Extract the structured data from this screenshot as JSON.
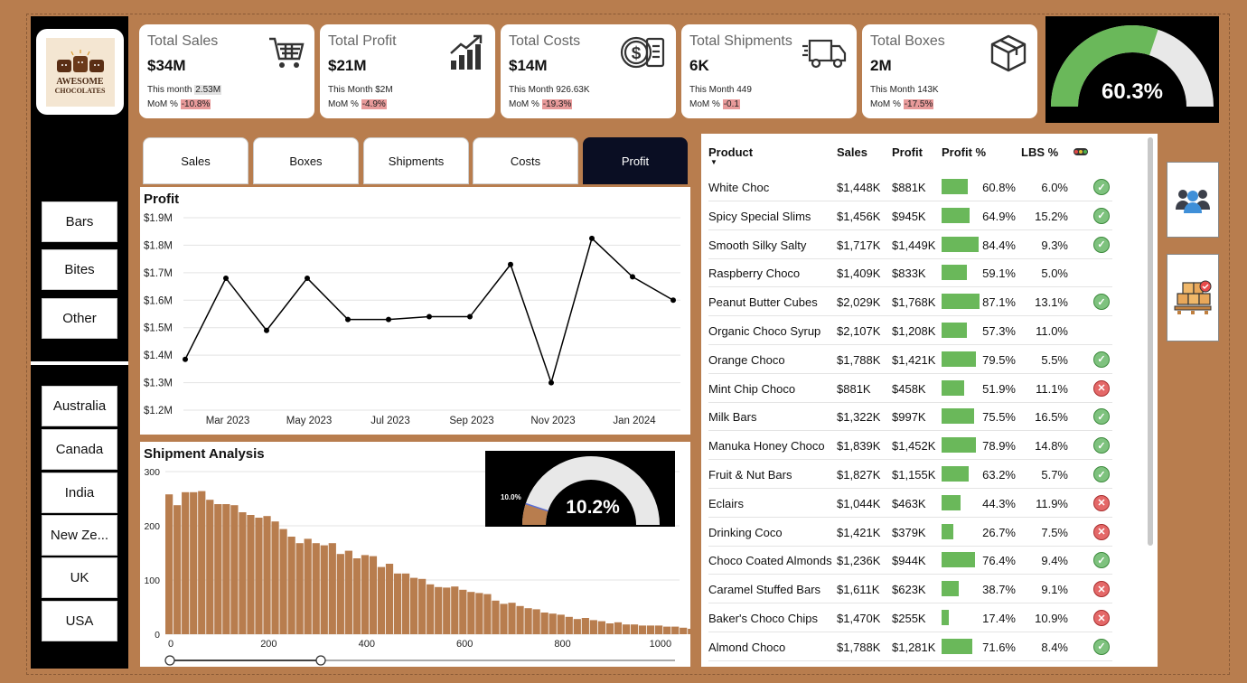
{
  "logo": {
    "line1": "AWESOME",
    "line2": "CHOCOLATES"
  },
  "product_slicer": [
    "Bars",
    "Bites",
    "Other"
  ],
  "country_slicer": [
    "Australia",
    "Canada",
    "India",
    "New Ze...",
    "UK",
    "USA"
  ],
  "kpis": [
    {
      "title": "Total Sales",
      "value": "$34M",
      "sub_label": "This month",
      "sub_value": "2.53M",
      "mom_label": "MoM %",
      "mom_value": "-10.8%",
      "icon": "shopping-cart-icon"
    },
    {
      "title": "Total Profit",
      "value": "$21M",
      "sub_label": "This Month",
      "sub_value": "$2M",
      "mom_label": "MoM %",
      "mom_value": "-4.9%",
      "icon": "growth-chart-icon"
    },
    {
      "title": "Total Costs",
      "value": "$14M",
      "sub_label": "This Month",
      "sub_value": "926.63K",
      "mom_label": "MoM %",
      "mom_value": "-19.3%",
      "icon": "dollar-invoice-icon"
    },
    {
      "title": "Total Shipments",
      "value": "6K",
      "sub_label": "This Month",
      "sub_value": "449",
      "mom_label": "MoM %",
      "mom_value": "-0.1",
      "icon": "truck-icon"
    },
    {
      "title": "Total Boxes",
      "value": "2M",
      "sub_label": "This Month",
      "sub_value": "143K",
      "mom_label": "MoM %",
      "mom_value": "-17.5%",
      "icon": "box-icon"
    }
  ],
  "main_gauge": {
    "label": "60.3%",
    "value": 0.603,
    "fill_color": "#6ab85a",
    "track_color": "#e8e8e8"
  },
  "tabs": [
    {
      "label": "Sales",
      "active": false
    },
    {
      "label": "Boxes",
      "active": false
    },
    {
      "label": "Shipments",
      "active": false
    },
    {
      "label": "Costs",
      "active": false
    },
    {
      "label": "Profit",
      "active": true
    }
  ],
  "chart_data": [
    {
      "type": "line",
      "title": "Profit",
      "x": [
        "2023-01",
        "2023-02",
        "2023-03",
        "2023-04",
        "2023-05",
        "2023-06",
        "2023-07",
        "2023-08",
        "2023-09",
        "2023-10",
        "2023-11",
        "2023-12",
        "2024-01",
        "2024-02",
        "2024-03"
      ],
      "values": [
        1.385,
        1.68,
        1.49,
        1.68,
        1.53,
        1.53,
        1.54,
        1.54,
        1.73,
        1.3,
        1.825,
        1.685,
        1.6
      ],
      "ylim": [
        1.2,
        1.9
      ],
      "yticks": [
        "$1.2M",
        "$1.3M",
        "$1.4M",
        "$1.5M",
        "$1.6M",
        "$1.7M",
        "$1.8M",
        "$1.9M"
      ],
      "ytick_values": [
        1.2,
        1.3,
        1.4,
        1.5,
        1.6,
        1.7,
        1.8,
        1.9
      ],
      "xticks": [
        "Mar 2023",
        "May 2023",
        "Jul 2023",
        "Sep 2023",
        "Nov 2023",
        "Jan 2024"
      ],
      "xtick_positions": [
        2,
        4,
        6,
        8,
        10,
        12
      ],
      "grid": true
    },
    {
      "type": "bar",
      "title": "Shipment Analysis",
      "xlim": [
        0,
        1050
      ],
      "ylim": [
        0,
        300
      ],
      "yticks": [
        "0",
        "100",
        "200",
        "300"
      ],
      "ytick_values": [
        0,
        100,
        200,
        300
      ],
      "xticks": [
        "0",
        "200",
        "400",
        "600",
        "800",
        "1000"
      ],
      "xtick_values": [
        0,
        200,
        400,
        600,
        800,
        1000
      ],
      "bar_color": "#b87d4e",
      "bin_width": 16.67,
      "values": [
        258,
        238,
        262,
        262,
        264,
        248,
        240,
        240,
        238,
        225,
        220,
        215,
        218,
        208,
        194,
        180,
        168,
        176,
        168,
        164,
        168,
        148,
        154,
        140,
        146,
        144,
        124,
        130,
        112,
        112,
        104,
        102,
        92,
        87,
        86,
        88,
        82,
        78,
        76,
        74,
        62,
        56,
        58,
        52,
        48,
        46,
        40,
        38,
        36,
        32,
        28,
        30,
        26,
        24,
        20,
        22,
        18,
        18,
        16,
        16,
        16,
        14,
        14,
        12,
        10,
        12,
        8
      ]
    }
  ],
  "small_gauge": {
    "label": "10.2%",
    "target_label": "10.0%",
    "value": 0.102,
    "fill_color": "#b87d4e",
    "track_color": "#e8e8e8"
  },
  "table": {
    "headers": {
      "product": "Product",
      "sales": "Sales",
      "profit": "Profit",
      "profit_pct": "Profit %",
      "lbs_pct": "LBS %"
    },
    "rows": [
      {
        "product": "White Choc",
        "sales": "$1,448K",
        "profit": "$881K",
        "profit_pct": "60.8%",
        "pct_value": 60.8,
        "lbs": "6.0%",
        "status": "ok"
      },
      {
        "product": "Spicy Special Slims",
        "sales": "$1,456K",
        "profit": "$945K",
        "profit_pct": "64.9%",
        "pct_value": 64.9,
        "lbs": "15.2%",
        "status": "ok"
      },
      {
        "product": "Smooth Silky Salty",
        "sales": "$1,717K",
        "profit": "$1,449K",
        "profit_pct": "84.4%",
        "pct_value": 84.4,
        "lbs": "9.3%",
        "status": "ok"
      },
      {
        "product": "Raspberry Choco",
        "sales": "$1,409K",
        "profit": "$833K",
        "profit_pct": "59.1%",
        "pct_value": 59.1,
        "lbs": "5.0%",
        "status": "none"
      },
      {
        "product": "Peanut Butter Cubes",
        "sales": "$2,029K",
        "profit": "$1,768K",
        "profit_pct": "87.1%",
        "pct_value": 87.1,
        "lbs": "13.1%",
        "status": "ok"
      },
      {
        "product": "Organic Choco Syrup",
        "sales": "$2,107K",
        "profit": "$1,208K",
        "profit_pct": "57.3%",
        "pct_value": 57.3,
        "lbs": "11.0%",
        "status": "none"
      },
      {
        "product": "Orange Choco",
        "sales": "$1,788K",
        "profit": "$1,421K",
        "profit_pct": "79.5%",
        "pct_value": 79.5,
        "lbs": "5.5%",
        "status": "ok"
      },
      {
        "product": "Mint Chip Choco",
        "sales": "$881K",
        "profit": "$458K",
        "profit_pct": "51.9%",
        "pct_value": 51.9,
        "lbs": "11.1%",
        "status": "bad"
      },
      {
        "product": "Milk Bars",
        "sales": "$1,322K",
        "profit": "$997K",
        "profit_pct": "75.5%",
        "pct_value": 75.5,
        "lbs": "16.5%",
        "status": "ok"
      },
      {
        "product": "Manuka Honey Choco",
        "sales": "$1,839K",
        "profit": "$1,452K",
        "profit_pct": "78.9%",
        "pct_value": 78.9,
        "lbs": "14.8%",
        "status": "ok"
      },
      {
        "product": "Fruit & Nut Bars",
        "sales": "$1,827K",
        "profit": "$1,155K",
        "profit_pct": "63.2%",
        "pct_value": 63.2,
        "lbs": "5.7%",
        "status": "ok"
      },
      {
        "product": "Eclairs",
        "sales": "$1,044K",
        "profit": "$463K",
        "profit_pct": "44.3%",
        "pct_value": 44.3,
        "lbs": "11.9%",
        "status": "bad"
      },
      {
        "product": "Drinking Coco",
        "sales": "$1,421K",
        "profit": "$379K",
        "profit_pct": "26.7%",
        "pct_value": 26.7,
        "lbs": "7.5%",
        "status": "bad"
      },
      {
        "product": "Choco Coated Almonds",
        "sales": "$1,236K",
        "profit": "$944K",
        "profit_pct": "76.4%",
        "pct_value": 76.4,
        "lbs": "9.4%",
        "status": "ok"
      },
      {
        "product": "Caramel Stuffed Bars",
        "sales": "$1,611K",
        "profit": "$623K",
        "profit_pct": "38.7%",
        "pct_value": 38.7,
        "lbs": "9.1%",
        "status": "bad"
      },
      {
        "product": "Baker's Choco Chips",
        "sales": "$1,470K",
        "profit": "$255K",
        "profit_pct": "17.4%",
        "pct_value": 17.4,
        "lbs": "10.9%",
        "status": "bad"
      },
      {
        "product": "Almond Choco",
        "sales": "$1,788K",
        "profit": "$1,281K",
        "profit_pct": "71.6%",
        "pct_value": 71.6,
        "lbs": "8.4%",
        "status": "ok"
      }
    ]
  },
  "side_buttons": [
    {
      "icon": "team-icon"
    },
    {
      "icon": "warehouse-boxes-icon"
    }
  ]
}
